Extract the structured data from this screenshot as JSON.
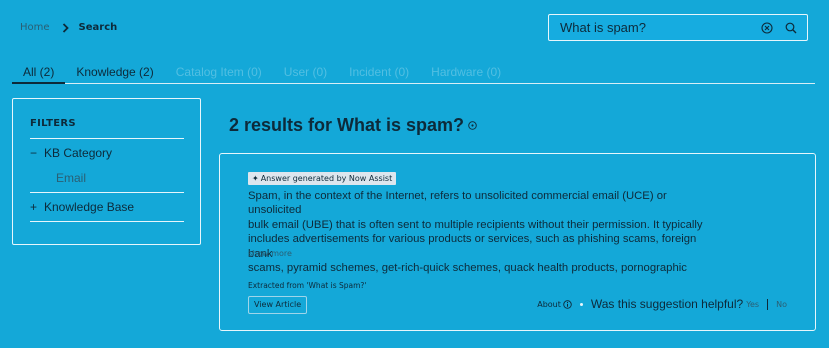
{
  "breadcrumb": {
    "home": "Home",
    "current": "Search"
  },
  "search": {
    "value": "What is spam?"
  },
  "tabs": [
    {
      "label": "All (2)",
      "state": "active"
    },
    {
      "label": "Knowledge (2)",
      "state": "enabled"
    },
    {
      "label": "Catalog Item (0)",
      "state": "disabled"
    },
    {
      "label": "User (0)",
      "state": "disabled"
    },
    {
      "label": "Incident (0)",
      "state": "disabled"
    },
    {
      "label": "Hardware (0)",
      "state": "disabled"
    }
  ],
  "filters": {
    "title": "FILTERS",
    "groups": [
      {
        "toggle": "−",
        "label": "KB Category",
        "options": [
          "Email"
        ]
      },
      {
        "toggle": "+",
        "label": "Knowledge Base",
        "options": []
      }
    ]
  },
  "results": {
    "heading": "2 results for What is spam?",
    "card": {
      "badge": "Answer generated by Now Assist",
      "answer_lines": [
        "Spam, in the context of the Internet, refers to unsolicited commercial email (UCE) or unsolicited",
        "bulk email (UBE) that is often sent to multiple recipients without their permission. It typically",
        "includes advertisements for various products or services, such as phishing scams, foreign bank",
        "scams, pyramid schemes, get-rich-quick schemes, quack health products, pornographic"
      ],
      "show_more": "show more",
      "extracted_from": "Extracted from 'What is Spam?'",
      "view_button": "View Article",
      "about": "About",
      "helpful_question": "Was this suggestion helpful?",
      "yes": "Yes",
      "no": "No"
    }
  },
  "colors": {
    "background": "#14a8d8",
    "text": "#0d2a3a",
    "border": "#e6f6fc",
    "badge": "#dde6ee"
  }
}
